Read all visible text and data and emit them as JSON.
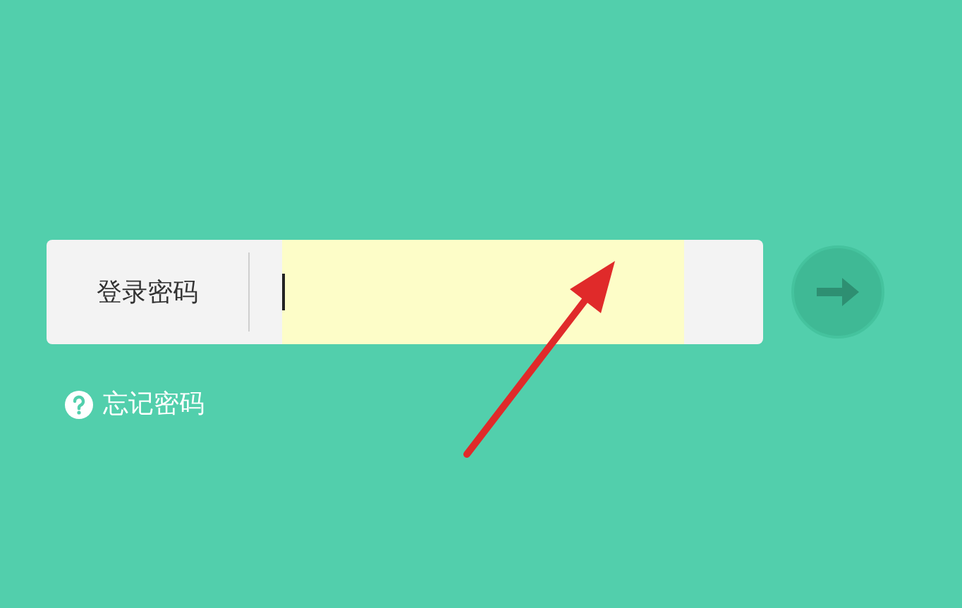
{
  "password_field": {
    "label": "登录密码",
    "highlighted": true,
    "focused": true
  },
  "forgot_link": {
    "label": "忘记密码"
  }
}
